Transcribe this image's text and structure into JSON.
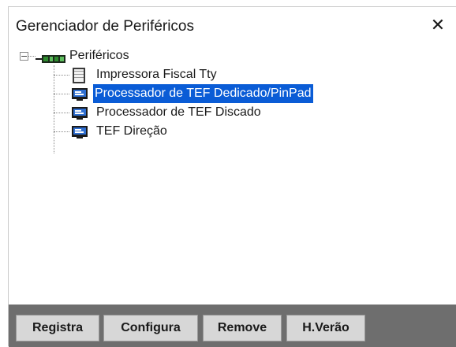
{
  "window": {
    "title": "Gerenciador de Periféricos",
    "close_label": "✕"
  },
  "tree": {
    "root": {
      "label": "Periféricos",
      "expander": "−",
      "icon": "computer-board-icon"
    },
    "children": [
      {
        "label": "Impressora Fiscal Tty",
        "icon": "printer-icon",
        "selected": false
      },
      {
        "label": "Processador de TEF Dedicado/PinPad",
        "icon": "monitor-device-icon",
        "selected": true
      },
      {
        "label": "Processador de TEF Discado",
        "icon": "monitor-device-icon",
        "selected": false
      },
      {
        "label": "TEF Direção",
        "icon": "monitor-device-icon",
        "selected": false
      }
    ]
  },
  "buttons": {
    "registra": "Registra",
    "configura": "Configura",
    "remove": "Remove",
    "hverao": "H.Verão"
  },
  "colors": {
    "selection": "#0a5cd6",
    "button_bar": "#6e6e6e",
    "button_face": "#d7d7d7"
  }
}
